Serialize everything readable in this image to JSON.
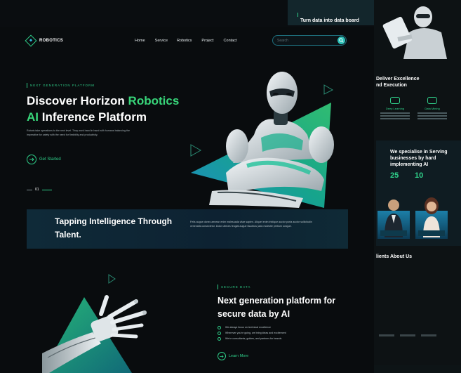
{
  "back_top": {
    "eyebrow": "",
    "title": "Turn data into data board"
  },
  "excel": {
    "line1": "Deliver Excellence",
    "line2": "nd Execution"
  },
  "features": [
    {
      "title": "Deep Learning"
    },
    {
      "title": "Data Mining"
    }
  ],
  "specialise": {
    "heading": "We specialise in Serving businesses by hard implementing AI",
    "stat1": "25",
    "stat2": "10"
  },
  "clients": {
    "heading": "lients About Us"
  },
  "nav": {
    "logo": "ROBOTICS",
    "menu": [
      "Home",
      "Service",
      "Robotics",
      "Project",
      "Contact"
    ],
    "search_placeholder": "Search"
  },
  "hero": {
    "eyebrow": "NEXT GENERATION PLATFORM",
    "title_a": "Discover Horizon ",
    "title_b": "Robotics",
    "title_c": "AI",
    "title_d": " Inference Platform",
    "description": "Robots take operations to the next level. They work hand in hand with humans balancing the imperative for safety with the need for flexibility and productivity.",
    "cta": "Get Started",
    "page": "01"
  },
  "band": {
    "title": "Tapping Intelligence Through Talent.",
    "text": "Felis augue donec aenean enim malesuada vitae sapien. Aliquet enim tristique auctor porta auctor sollicitudin venenatis consectetur. Dolor ultrices feugiat augue faucibus justo molestie pretium congue."
  },
  "secure": {
    "eyebrow": "SECURE DATA",
    "title": "Next generation platform for secure data by AI",
    "checks": [
      "We always focus on technical excellence",
      "Wherever you're going, we bring ideas and excitement",
      "We're consultants, guides, and partners for brands"
    ],
    "cta": "Learn More"
  },
  "colors": {
    "accent": "#2fd08a",
    "teal": "#2cc1b8",
    "bg": "#0a0d10"
  }
}
